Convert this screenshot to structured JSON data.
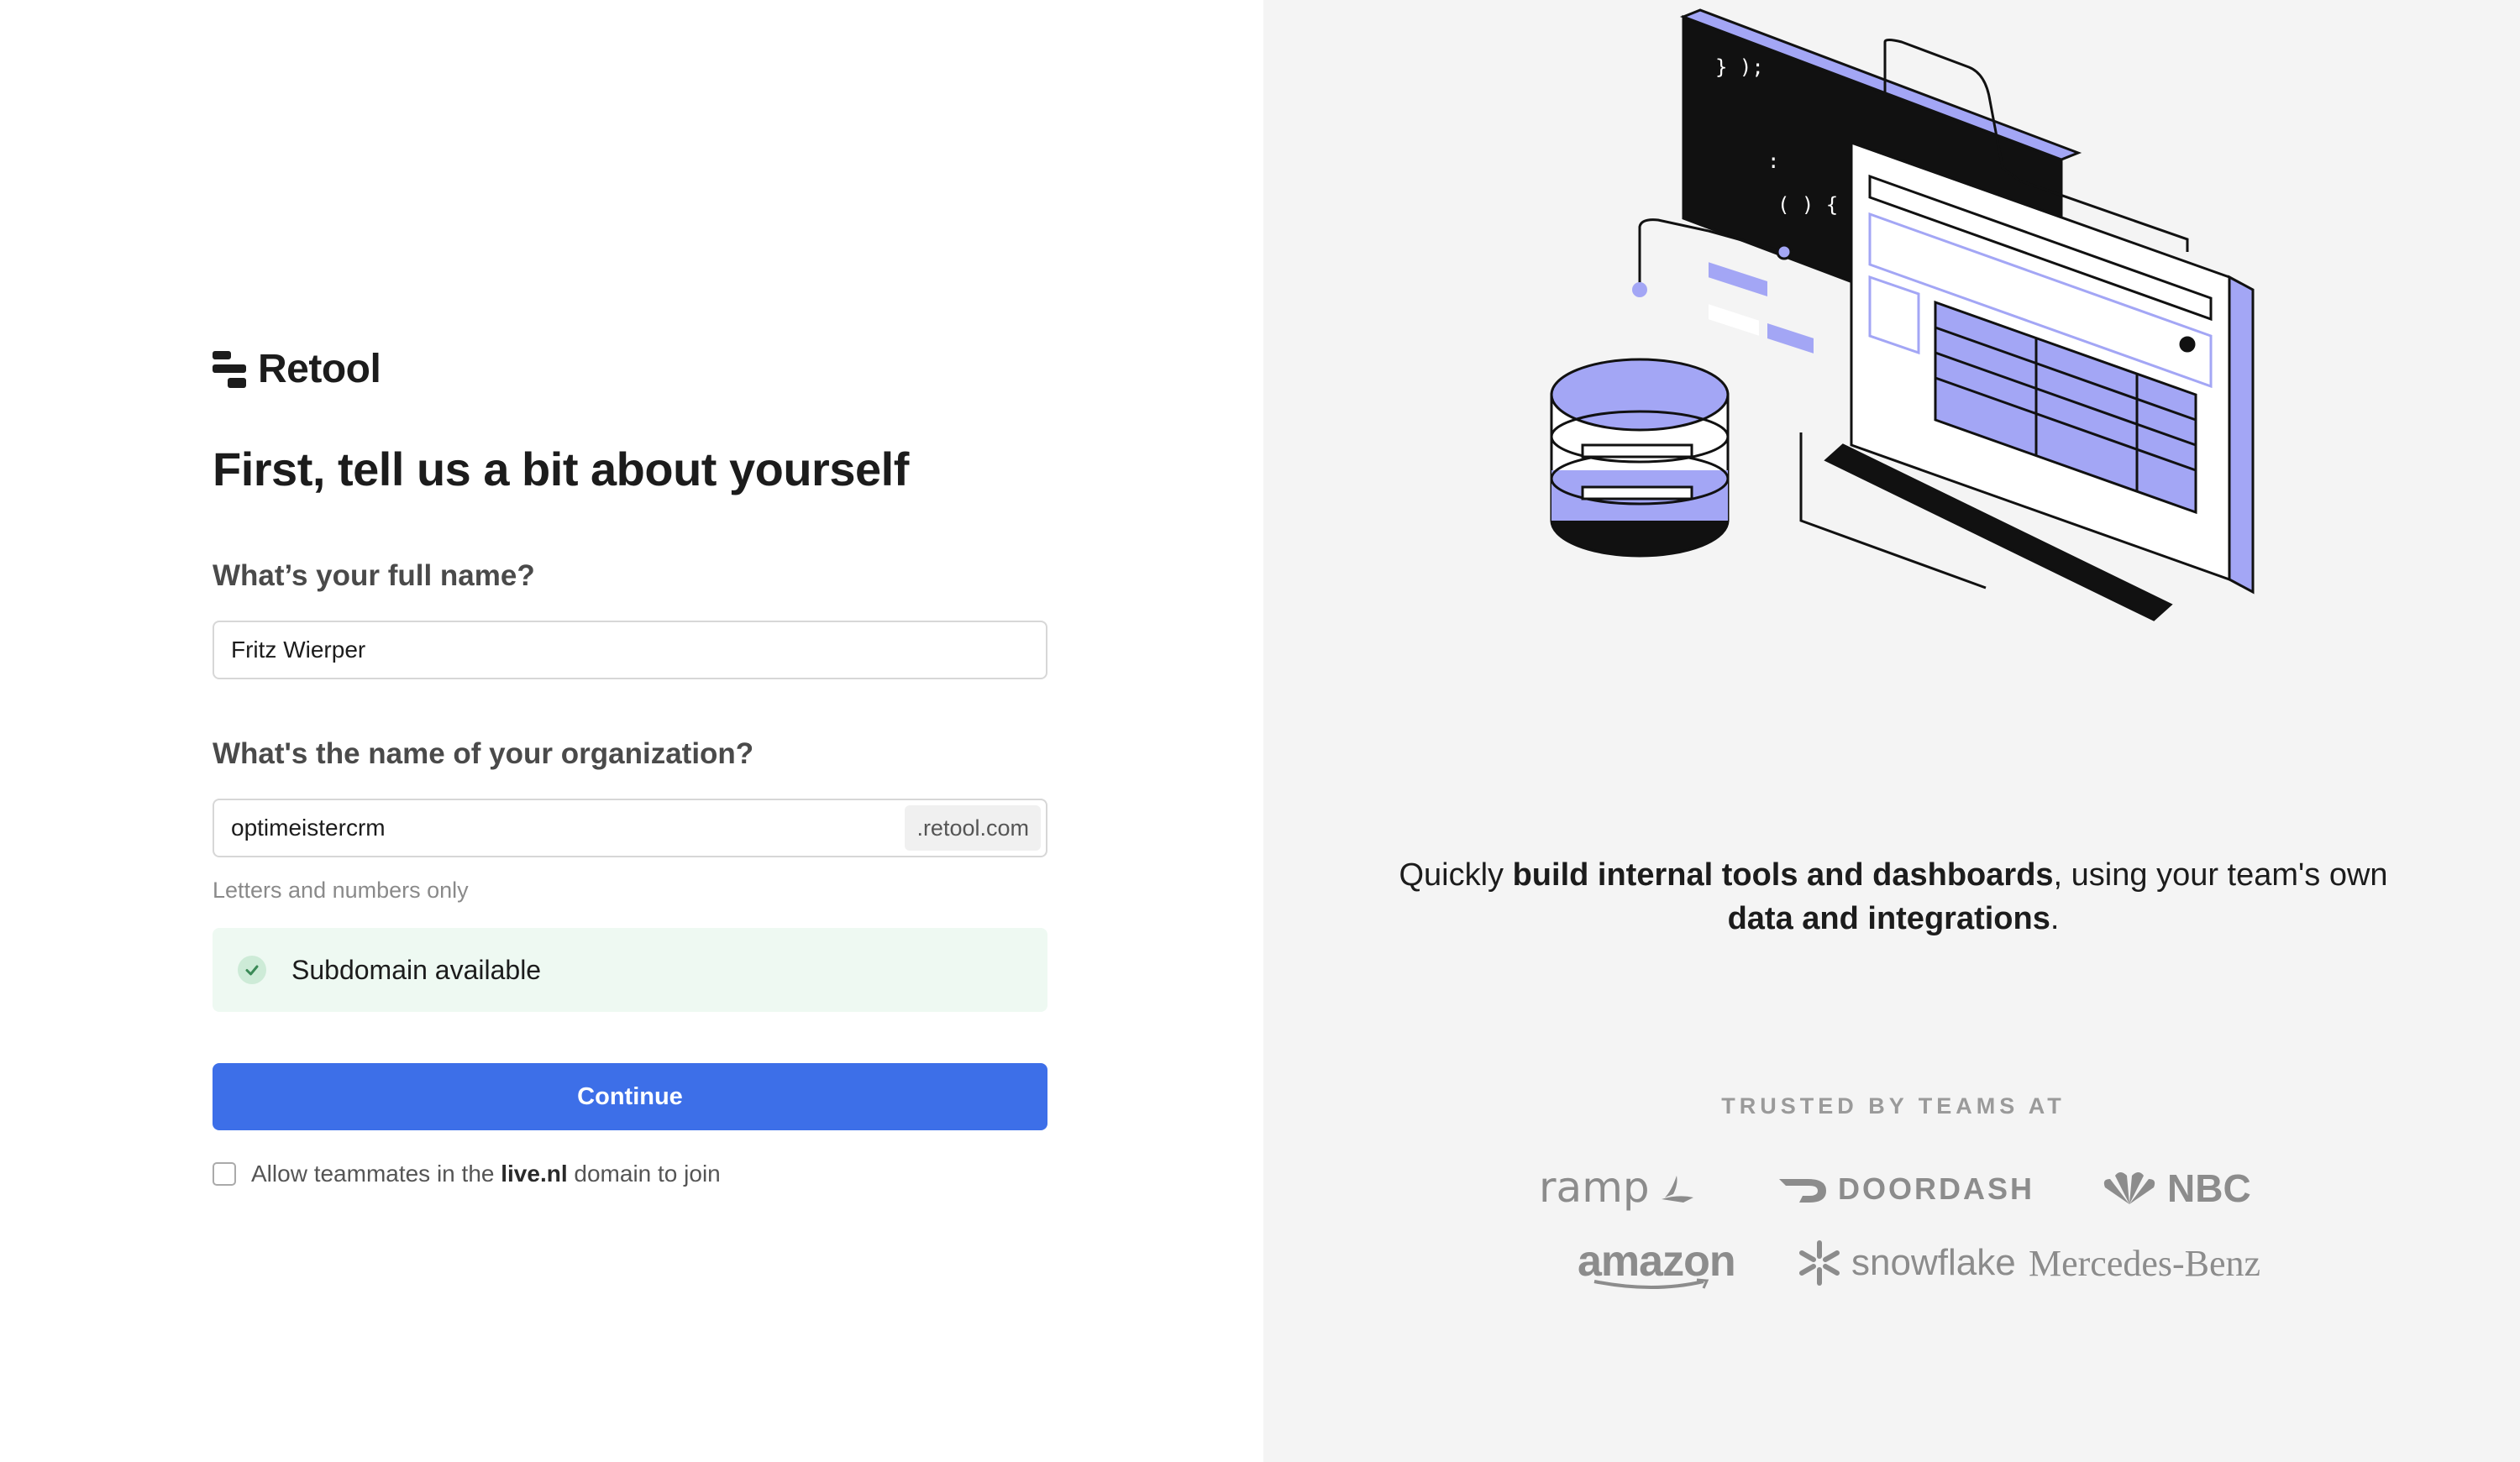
{
  "brand": {
    "name": "Retool"
  },
  "form": {
    "title": "First, tell us a bit about yourself",
    "name_label": "What’s your full name?",
    "name_value": "Fritz Wierper",
    "org_label": "What's the name of your organization?",
    "org_value": "optimeistercrm",
    "org_suffix": ".retool.com",
    "org_hint": "Letters and numbers only",
    "availability": "Subdomain available",
    "continue_label": "Continue",
    "allow_prefix": "Allow teammates in the ",
    "allow_domain": "live.nl",
    "allow_suffix": " domain to join",
    "allow_checked": false
  },
  "promo": {
    "illustration_code": [
      "} );",
      ":",
      "( ) {"
    ],
    "tagline_1": "Quickly ",
    "tagline_bold_1": "build internal tools and dashboards",
    "tagline_2": ", using your team's own ",
    "tagline_bold_2": "data and integrations",
    "tagline_3": ".",
    "trusted_label": "TRUSTED BY TEAMS AT",
    "logos": [
      "ramp",
      "DOORDASH",
      "NBC",
      "amazon",
      "snowflake",
      "Mercedes-Benz"
    ]
  },
  "colors": {
    "primary": "#3d6fe8",
    "accent_purple": "#a3a6f5",
    "success_bg": "#eef9f2",
    "success_icon": "#3b8a57",
    "panel_bg": "#f4f4f4"
  }
}
